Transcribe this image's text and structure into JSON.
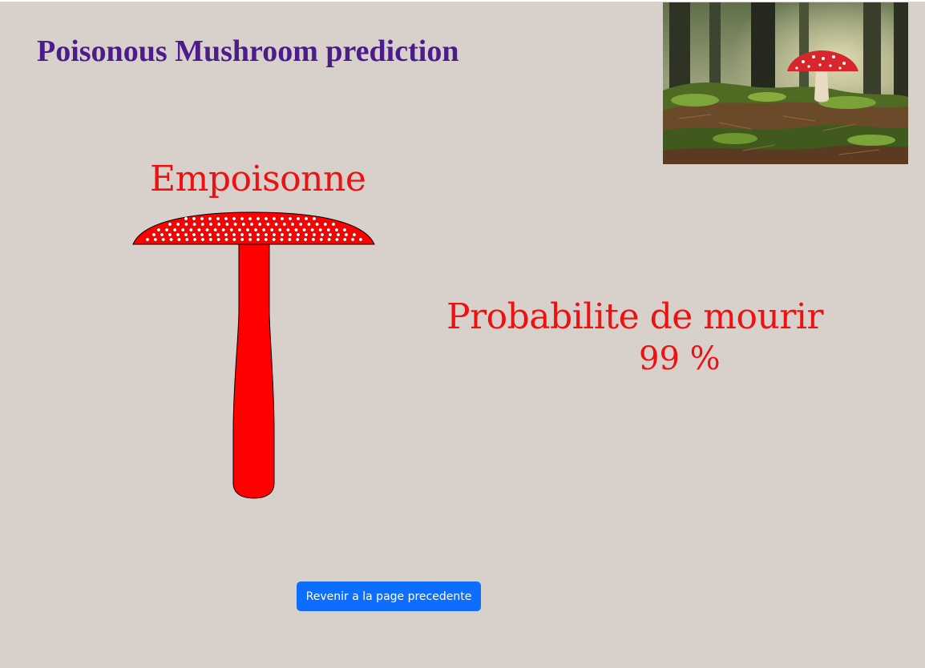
{
  "header": {
    "title": "Poisonous Mushroom prediction"
  },
  "result": {
    "verdict": "Empoisonne",
    "probability_label": "Probabilite de mourir",
    "probability_value": "99 %",
    "probability_percent": 99
  },
  "actions": {
    "back_label": "Revenir a la page precedente"
  },
  "colors": {
    "background": "#d8d0cb",
    "title": "#4b1c8a",
    "result_text": "#ee1111",
    "mushroom_fill": "#ff0000",
    "button": "#0d6efd"
  },
  "icons": {
    "mushroom": "fly-agaric-mushroom-icon",
    "photo": "forest-mushroom-photo"
  }
}
